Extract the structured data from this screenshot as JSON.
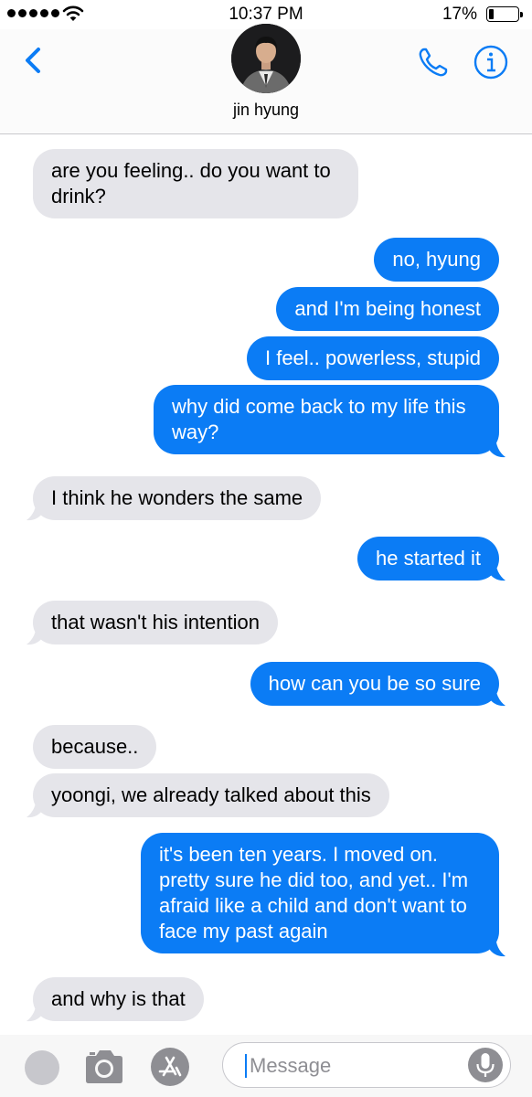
{
  "status_bar": {
    "time": "10:37 PM",
    "battery_percent": "17%",
    "battery_level": 0.17,
    "signal_bars": 5
  },
  "header": {
    "contact_name": "jin hyung",
    "back_icon": "chevron-left-icon",
    "call_icon": "phone-icon",
    "info_icon": "info-icon"
  },
  "colors": {
    "incoming_bubble": "#e5e5ea",
    "outgoing_bubble": "#0b7cf5",
    "accent": "#0b7cf5"
  },
  "messages": [
    {
      "from": "contact",
      "text": "are you feeling.. do you want to drink?"
    },
    {
      "from": "me",
      "text": "no, hyung"
    },
    {
      "from": "me",
      "text": "and I'm being honest"
    },
    {
      "from": "me",
      "text": "I feel.. powerless, stupid"
    },
    {
      "from": "me",
      "text": "why did come back to my life this way?"
    },
    {
      "from": "contact",
      "text": "I think he wonders the same"
    },
    {
      "from": "me",
      "text": "he started it"
    },
    {
      "from": "contact",
      "text": "that wasn't his intention"
    },
    {
      "from": "me",
      "text": "how can you be so sure"
    },
    {
      "from": "contact",
      "text": "because.."
    },
    {
      "from": "contact",
      "text": "yoongi, we already talked about this"
    },
    {
      "from": "me",
      "text": "it's been ten years. I moved on. pretty sure he did too, and yet.. I'm afraid like a child and don't want to face my past again"
    },
    {
      "from": "contact",
      "text": "and why is that"
    }
  ],
  "input_bar": {
    "placeholder": "Message",
    "apps_icon": "apps-icon",
    "camera_icon": "camera-icon",
    "app_store_icon": "app-store-icon",
    "mic_icon": "microphone-icon"
  }
}
